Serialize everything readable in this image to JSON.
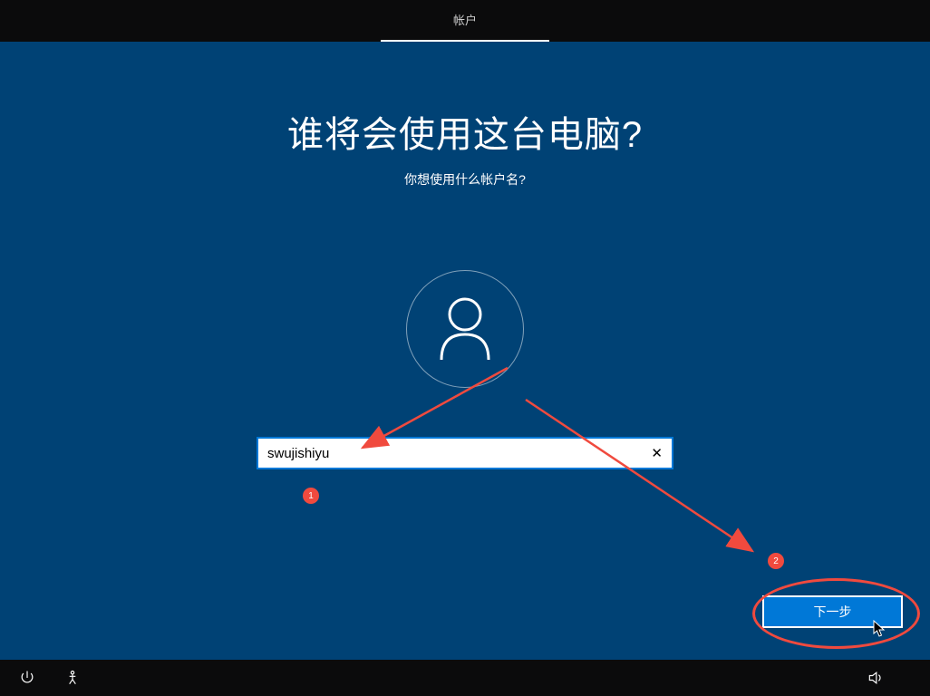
{
  "topbar": {
    "active_tab": "帐户"
  },
  "main": {
    "title": "谁将会使用这台电脑?",
    "subtitle": "你想使用什么帐户名?",
    "username_value": "swujishiyu",
    "next_label": "下一步"
  },
  "annotations": {
    "marker1": "1",
    "marker2": "2"
  },
  "colors": {
    "background_main": "#004275",
    "background_bars": "#0b0b0c",
    "accent": "#0078d7",
    "annotation_red": "#f04a3e"
  }
}
